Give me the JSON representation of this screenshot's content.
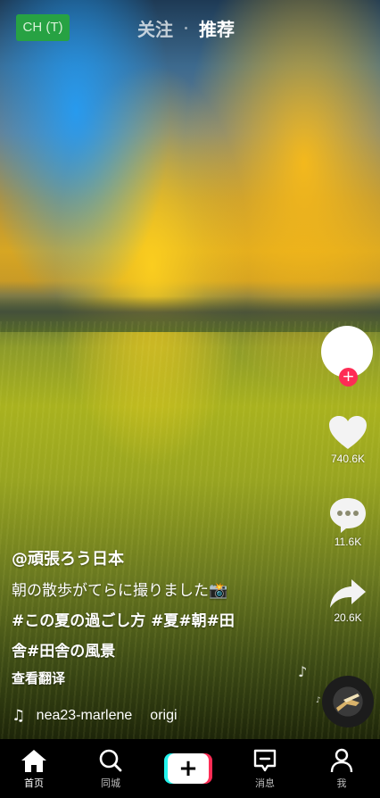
{
  "top": {
    "badge": "CH (T)",
    "tabs": [
      {
        "label": "关注"
      },
      {
        "label": "推荐"
      }
    ]
  },
  "actions": {
    "likes": "740.6K",
    "comments": "11.6K",
    "shares": "20.6K"
  },
  "caption": {
    "username": "@頑張ろう日本",
    "line1": "朝の散歩がてらに撮りました📸",
    "hashtags1": "#この夏の過ごし方 #夏#朝#田",
    "hashtags2": "舎#田舎の風景",
    "translate": "查看翻译"
  },
  "music": {
    "author": "nea23-marlene",
    "title_part": "origi"
  },
  "nav": [
    {
      "label": "首页",
      "icon": "home-icon"
    },
    {
      "label": "同城",
      "icon": "search-icon"
    },
    {
      "label": "",
      "icon": "plus-icon"
    },
    {
      "label": "消息",
      "icon": "message-icon"
    },
    {
      "label": "我",
      "icon": "profile-icon"
    }
  ],
  "colors": {
    "badge_bg": "#27a243",
    "accent_red": "#fe2c55",
    "accent_cyan": "#25f4ee",
    "nav_bg": "#000000"
  }
}
